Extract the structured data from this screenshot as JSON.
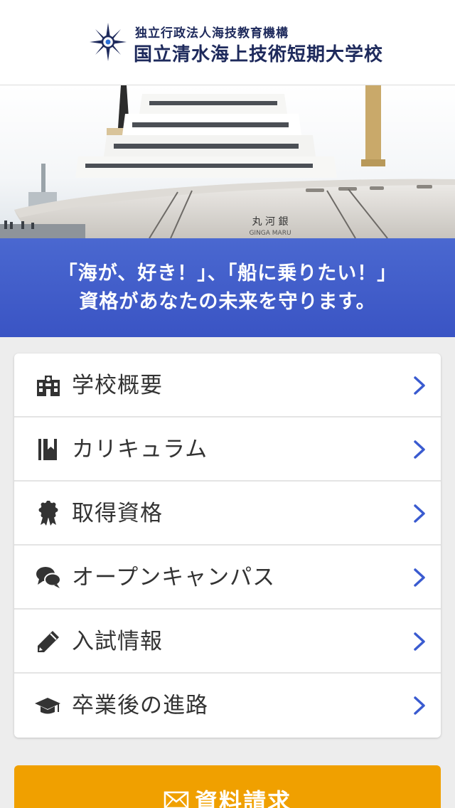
{
  "header": {
    "org_name": "独立行政法人海技教育機構",
    "school_name": "国立清水海上技術短期大学校",
    "brand_color": "#1e2a5c"
  },
  "hero": {
    "image_subject": "training ship at pier",
    "ship_name_kanji": "丸 河 銀",
    "ship_name_romaji": "GINGA  MARU"
  },
  "banner": {
    "line1": "「海が、好き！」、「船に乗りたい！」",
    "line2": "資格があなたの未来を守ります。",
    "color": "#3f5cc9"
  },
  "menu": {
    "items": [
      {
        "label": "学校概要",
        "icon": "school-building-icon"
      },
      {
        "label": "カリキュラム",
        "icon": "book-icon"
      },
      {
        "label": "取得資格",
        "icon": "award-badge-icon"
      },
      {
        "label": "オープンキャンパス",
        "icon": "chat-bubbles-icon"
      },
      {
        "label": "入試情報",
        "icon": "pencil-icon"
      },
      {
        "label": "卒業後の進路",
        "icon": "graduation-cap-icon"
      }
    ],
    "chevron_color": "#3a5bd0"
  },
  "cta": {
    "label": "資料請求",
    "icon": "envelope-icon",
    "color": "#f0a000"
  }
}
